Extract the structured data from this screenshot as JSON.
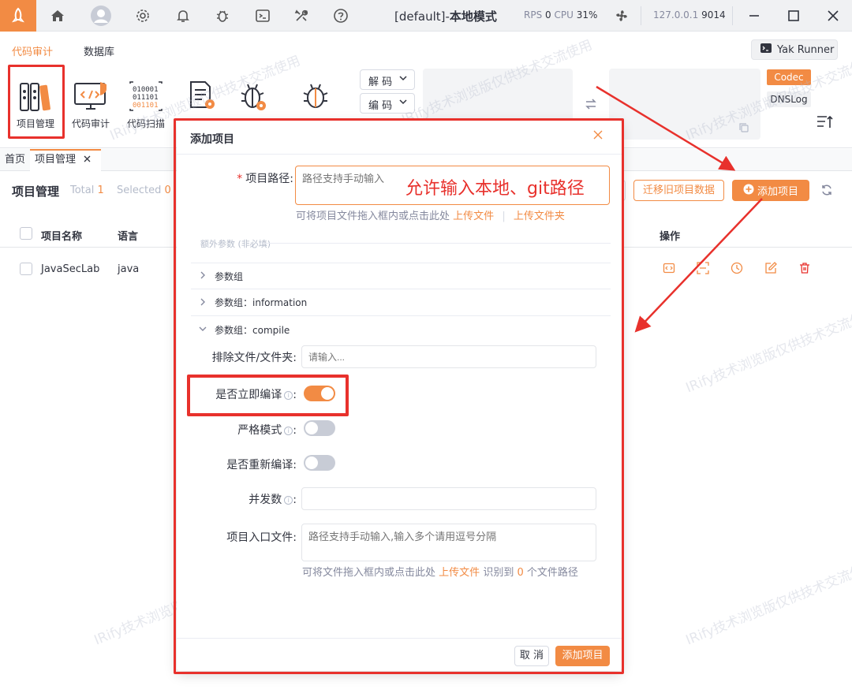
{
  "titlebar": {
    "title_prefix": "[default]-",
    "title_mode": "本地模式",
    "rps_label": "RPS",
    "rps_value": "0",
    "cpu_label": "CPU",
    "cpu_value": "31%",
    "ip_value": "127.0.0.1",
    "port_value": "9014"
  },
  "ribbon": {
    "tabs": [
      {
        "label": "代码审计"
      },
      {
        "label": "数据库"
      }
    ],
    "tools": [
      {
        "label": "项目管理"
      },
      {
        "label": "代码审计"
      },
      {
        "label": "代码扫描"
      }
    ],
    "decode_label": "解 码",
    "encode_label": "编 码",
    "codec_label": "Codec",
    "dnslog_label": "DNSLog",
    "yak_runner_label": "Yak Runner"
  },
  "pagetabs": [
    {
      "label": "首页"
    },
    {
      "label": "项目管理"
    }
  ],
  "project_page": {
    "title": "项目管理",
    "total_label": "Total",
    "total_value": "1",
    "selected_label": "Selected",
    "selected_value": "0",
    "migrate_button": "迁移旧项目数据",
    "add_button": "添加项目",
    "columns": [
      "项目名称",
      "语言",
      "操作"
    ],
    "rows": [
      {
        "name": "JavaSecLab",
        "language": "java"
      }
    ]
  },
  "modal": {
    "title": "添加项目",
    "path_label": "项目路径:",
    "path_placeholder": "路径支持手动输入",
    "path_hint": "可将项目文件拖入框内或点击此处",
    "upload_file": "上传文件",
    "upload_folder": "上传文件夹",
    "extra_params": "额外参数 (非必填)",
    "param_groups": [
      {
        "label": "参数组"
      },
      {
        "label": "参数组：information"
      },
      {
        "label": "参数组：compile"
      }
    ],
    "exclude_label": "排除文件/文件夹:",
    "exclude_placeholder": "请输入...",
    "compile_now_label": "是否立即编译",
    "compile_now_on": true,
    "strict_label": "严格模式",
    "strict_on": false,
    "recompile_label": "是否重新编译:",
    "recompile_on": false,
    "concurrency_label": "并发数",
    "entry_label": "项目入口文件:",
    "entry_placeholder": "路径支持手动输入,输入多个请用逗号分隔",
    "entry_hint_prefix": "可将文件拖入框内或点击此处",
    "entry_upload": "上传文件",
    "entry_hint_mid": "识别到",
    "entry_count": "0",
    "entry_hint_suffix": "个文件路径",
    "cancel_button": "取 消",
    "submit_button": "添加项目"
  },
  "annotation_text": "允许输入本地、git路径",
  "watermark_text": "IRify技术浏览版仅供技术交流使用",
  "colors": {
    "accent": "#f28b44",
    "annotation_red": "#e8312c"
  }
}
